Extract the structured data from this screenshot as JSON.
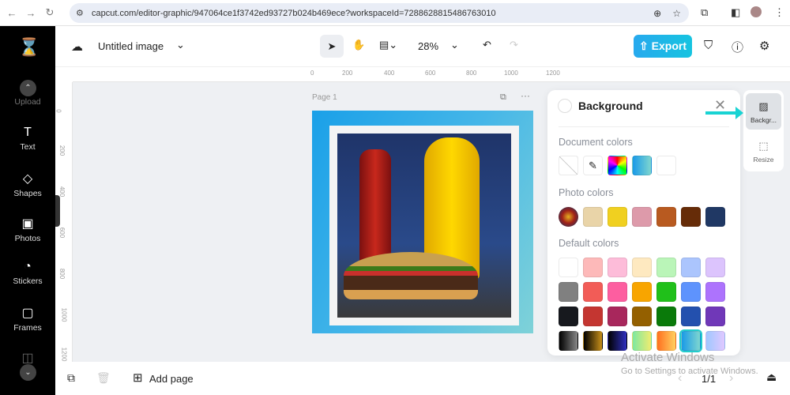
{
  "browser": {
    "url": "capcut.com/editor-graphic/947064ce1f3742ed93727b024b469ece?workspaceId=7288628815486763010"
  },
  "sidebar": {
    "items": [
      {
        "label": "Upload",
        "icon": "upload-icon"
      },
      {
        "label": "Text",
        "icon": "T"
      },
      {
        "label": "Shapes",
        "icon": "shapes-icon"
      },
      {
        "label": "Photos",
        "icon": "photo-icon"
      },
      {
        "label": "Stickers",
        "icon": "sticker-icon"
      },
      {
        "label": "Frames",
        "icon": "frame-icon"
      }
    ]
  },
  "topbar": {
    "title": "Untitled image",
    "zoom": "28%",
    "export": "Export"
  },
  "ruler": {
    "h": [
      "0",
      "200",
      "400",
      "600",
      "800",
      "1000",
      "1200"
    ],
    "v": [
      "0",
      "200",
      "400",
      "600",
      "800",
      "1000",
      "1200"
    ]
  },
  "canvas": {
    "page_label": "Page 1"
  },
  "panel": {
    "title": "Background",
    "document_colors_label": "Document colors",
    "photo_colors_label": "Photo colors",
    "default_colors_label": "Default colors",
    "document_colors": [
      "none",
      "eyedropper",
      "conic",
      "linear-gradient(90deg,#1a9ae8,#7fd6cf)",
      "#ffffff"
    ],
    "photo_colors": [
      "#e9d4a8",
      "#f0d020",
      "#dd9aaa",
      "#b85a20",
      "#662c08",
      "#203864"
    ],
    "default_colors": [
      [
        "#ffffff",
        "#fdb9b9",
        "#fdbcd9",
        "#fee9c0",
        "#baf5b8",
        "#abc5fd",
        "#dcc4fd"
      ],
      [
        "#808080",
        "#f25c57",
        "#fd5ea0",
        "#f8a500",
        "#20c01a",
        "#5e93fd",
        "#ad73fd"
      ],
      [
        "#17191e",
        "#c43631",
        "#a8275c",
        "#946000",
        "#0a7a0a",
        "#2350ae",
        "#7038b8"
      ],
      [
        "linear-gradient(90deg,#000,#888)",
        "linear-gradient(90deg,#000,#c8901a)",
        "linear-gradient(90deg,#000,#3030c0)",
        "linear-gradient(90deg,#7de8a0,#f0ec70)",
        "linear-gradient(90deg,#ff7020,#ffd060)",
        "linear-gradient(90deg,#1a9ae8,#7fd6cf)",
        "linear-gradient(90deg,#a0c8ff,#e0c8ff)"
      ]
    ]
  },
  "right_panel": {
    "background": "Backgr...",
    "resize": "Resize"
  },
  "bottom": {
    "add_page": "Add page",
    "pagination": "1/1"
  },
  "watermark": {
    "line1": "Activate Windows",
    "line2": "Go to Settings to activate Windows."
  }
}
